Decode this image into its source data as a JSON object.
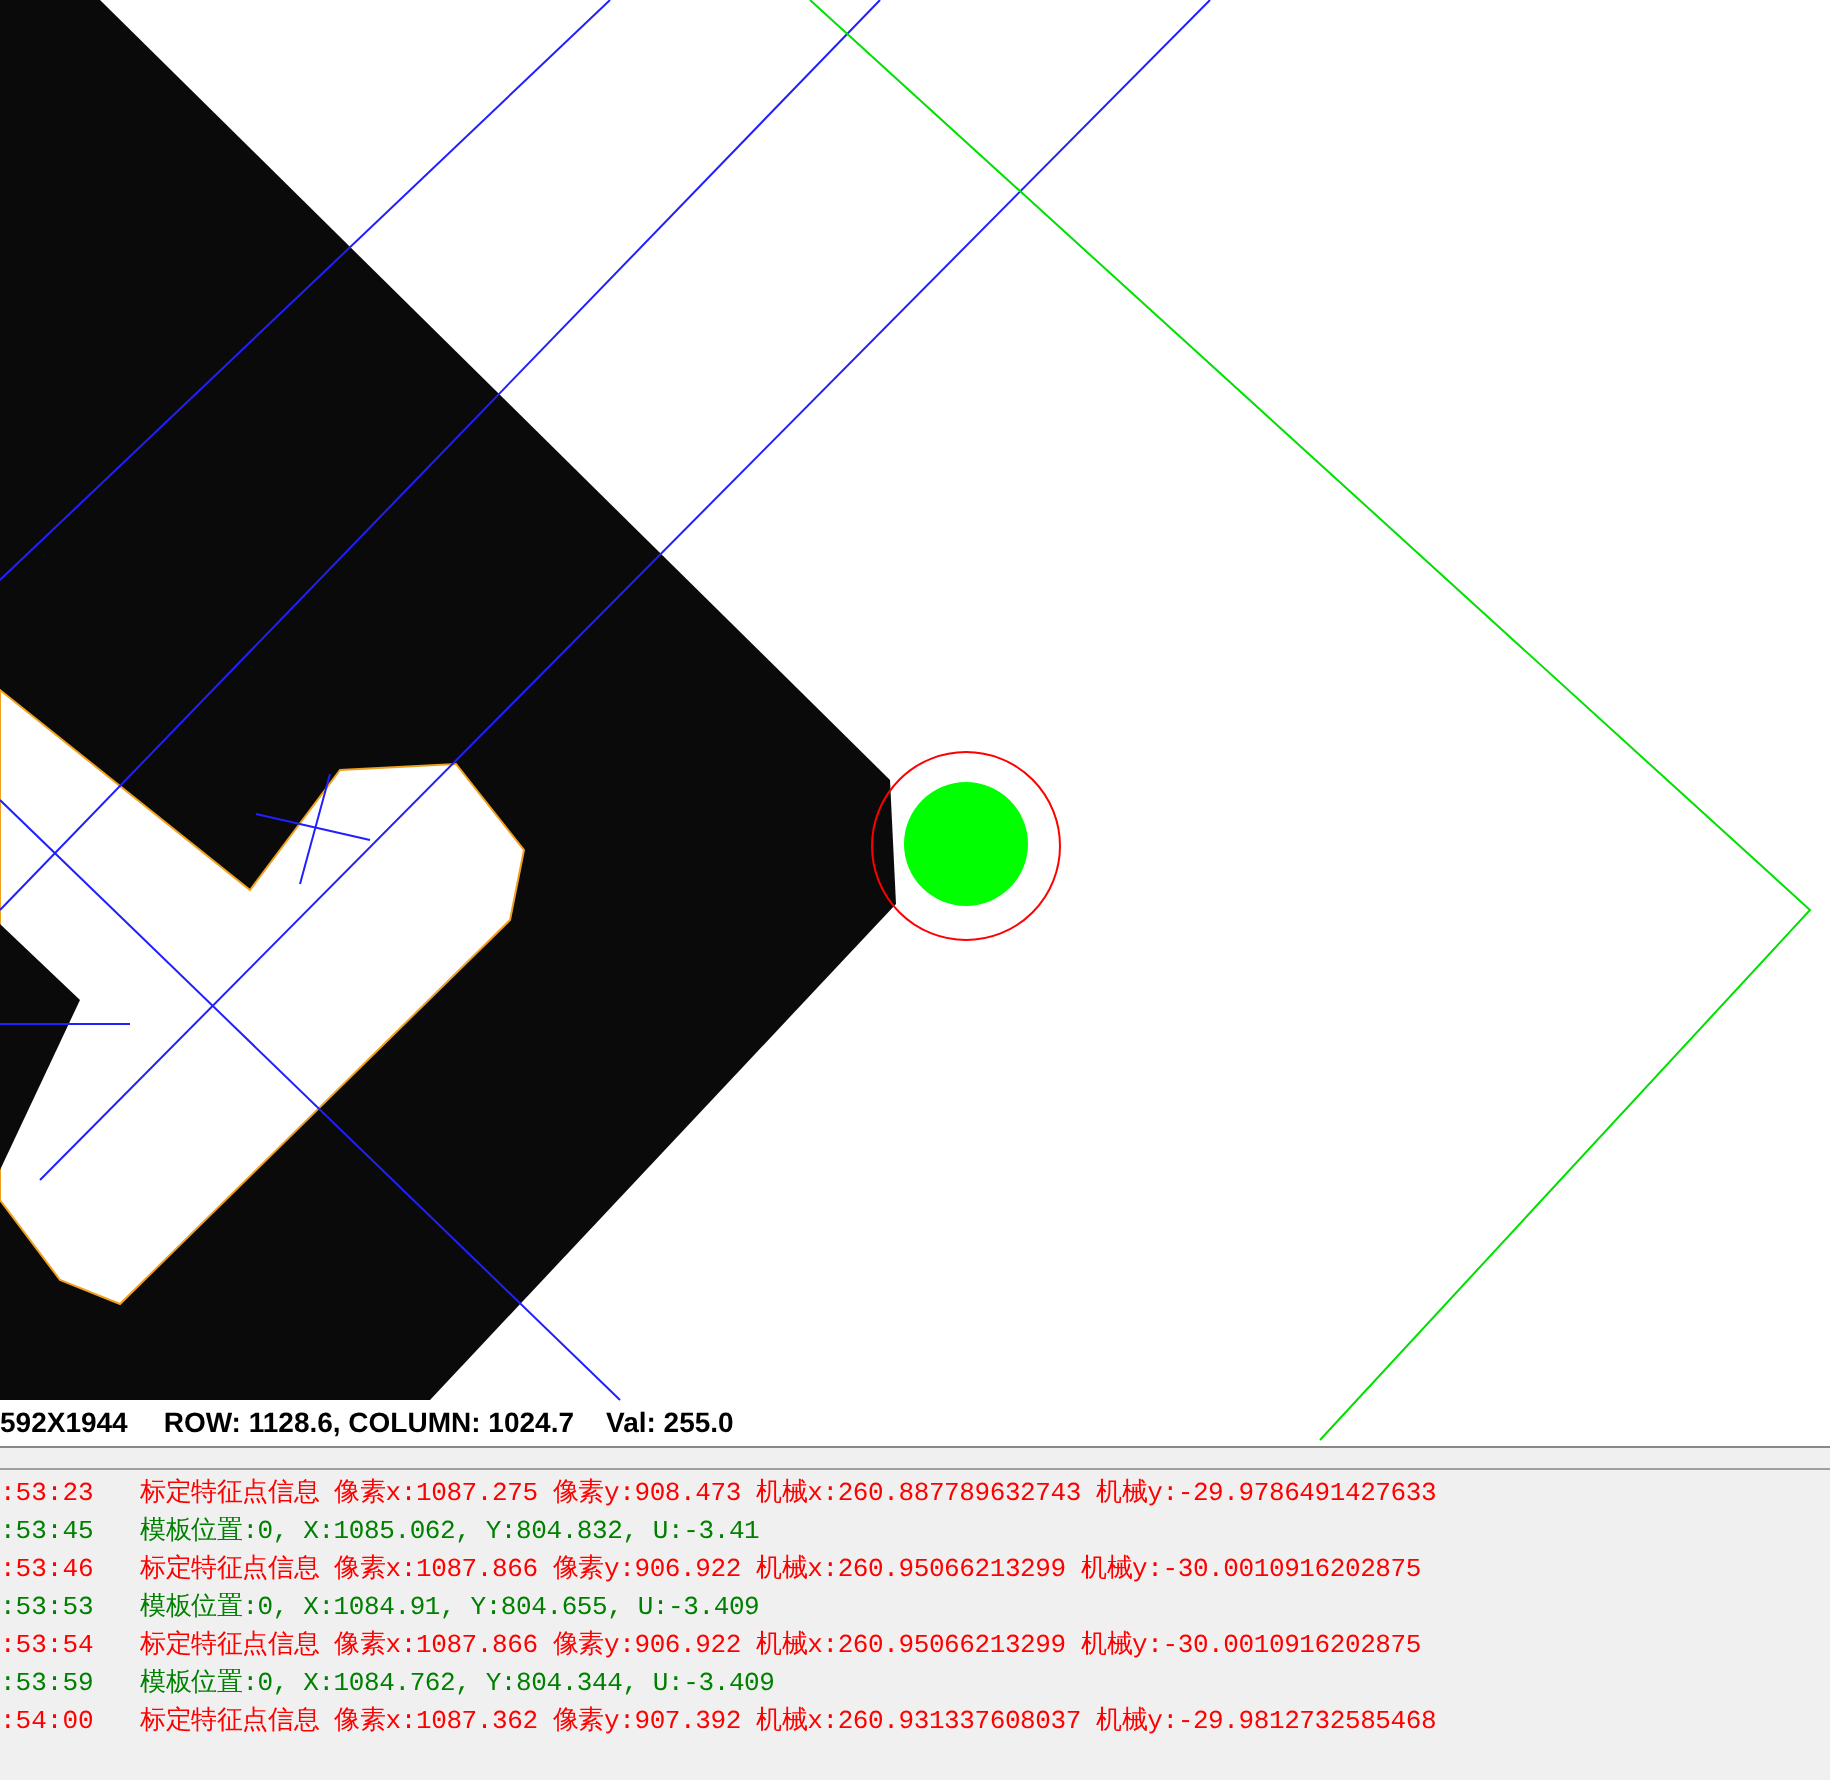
{
  "image_status": {
    "size": "592X1944",
    "position": "ROW: 1128.6, COLUMN: 1024.7",
    "value": "Val: 255.0"
  },
  "log": [
    {
      "kind": "calibration",
      "time": ":53:23",
      "message": "标定特征点信息 像素x:1087.275 像素y:908.473 机械x:260.887789632743 机械y:-29.9786491427633"
    },
    {
      "kind": "template",
      "time": ":53:45",
      "message": "模板位置:0, X:1085.062, Y:804.832, U:-3.41"
    },
    {
      "kind": "calibration",
      "time": ":53:46",
      "message": "标定特征点信息 像素x:1087.866 像素y:906.922 机械x:260.95066213299 机械y:-30.0010916202875"
    },
    {
      "kind": "template",
      "time": ":53:53",
      "message": "模板位置:0, X:1084.91, Y:804.655, U:-3.409"
    },
    {
      "kind": "calibration",
      "time": ":53:54",
      "message": "标定特征点信息 像素x:1087.866 像素y:906.922 机械x:260.95066213299 机械y:-30.0010916202875"
    },
    {
      "kind": "template",
      "time": ":53:59",
      "message": "模板位置:0, X:1084.762, Y:804.344, U:-3.409"
    },
    {
      "kind": "calibration",
      "time": ":54:00",
      "message": "标定特征点信息 像素x:1087.362 像素y:907.392 机械x:260.931337608037 机械y:-29.9812732585468"
    }
  ]
}
